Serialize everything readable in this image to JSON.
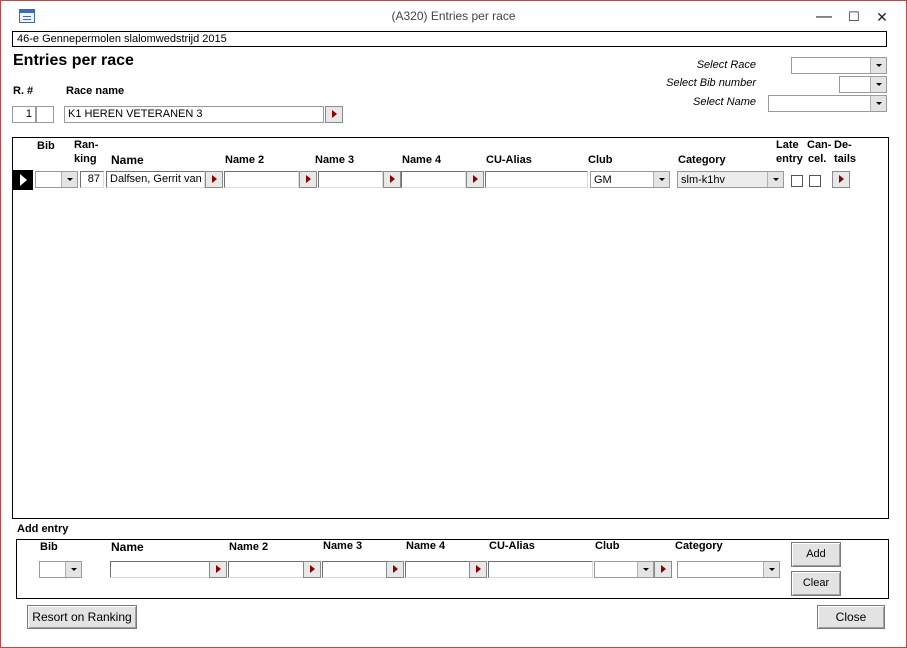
{
  "window": {
    "title": "(A320) Entries per race",
    "minimize": "—",
    "maximize": "☐",
    "close": "✕"
  },
  "event_title": "46-e Gennepermolen slalomwedstrijd 2015",
  "page_title": "Entries per race",
  "filters": {
    "select_race_label": "Select Race",
    "select_race_value": "",
    "select_bib_label": "Select Bib number",
    "select_bib_value": "",
    "select_name_label": "Select Name",
    "select_name_value": ""
  },
  "race": {
    "number_label": "R. #",
    "name_label": "Race name",
    "number_value": "1",
    "number_extra": "",
    "name_value": "K1  HEREN VETERANEN 3"
  },
  "grid": {
    "headers": {
      "bib": "Bib",
      "ranking_1": "Ran-",
      "ranking_2": "king",
      "name": "Name",
      "name2": "Name 2",
      "name3": "Name 3",
      "name4": "Name 4",
      "cu_alias": "CU-Alias",
      "club": "Club",
      "category": "Category",
      "late_1": "Late",
      "late_2": "entry",
      "cancel_1": "Can-",
      "cancel_2": "cel.",
      "details_1": "De-",
      "details_2": "tails"
    },
    "rows": [
      {
        "bib": "",
        "ranking": "87",
        "name": "Dalfsen, Gerrit van",
        "name2": "",
        "name3": "",
        "name4": "",
        "cu_alias": "",
        "club": "GM",
        "category": "slm-k1hv",
        "late_entry": false,
        "cancelled": false
      }
    ]
  },
  "add_entry": {
    "section_label": "Add entry",
    "headers": {
      "bib": "Bib",
      "name": "Name",
      "name2": "Name 2",
      "name3": "Name 3",
      "name4": "Name 4",
      "cu_alias": "CU-Alias",
      "club": "Club",
      "category": "Category"
    },
    "values": {
      "bib": "",
      "name": "",
      "name2": "",
      "name3": "",
      "name4": "",
      "cu_alias": "",
      "club": "",
      "category": ""
    },
    "add_label": "Add",
    "clear_label": "Clear"
  },
  "footer": {
    "resort_label": "Resort on Ranking",
    "close_label": "Close"
  }
}
